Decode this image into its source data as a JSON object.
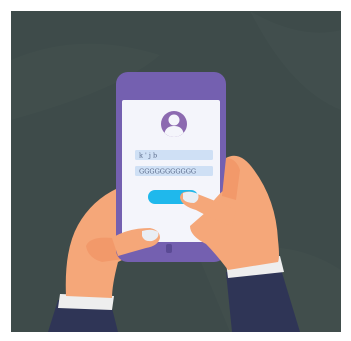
{
  "login_form": {
    "username_value": "k ' j b",
    "password_value": "GGGGGGGGGGG",
    "login_button_label": ""
  },
  "colors": {
    "background": "#3e4b4a",
    "phone_body": "#7460b0",
    "screen": "#f4f5fb",
    "avatar": "#8c6ab0",
    "input_fill": "#cfe0f5",
    "button": "#1fb8ec",
    "skin": "#f5a779",
    "sleeve": "#2f3556",
    "cuff": "#eeeeee"
  },
  "icons": {
    "avatar": "user-icon",
    "home": "home-button-icon"
  }
}
